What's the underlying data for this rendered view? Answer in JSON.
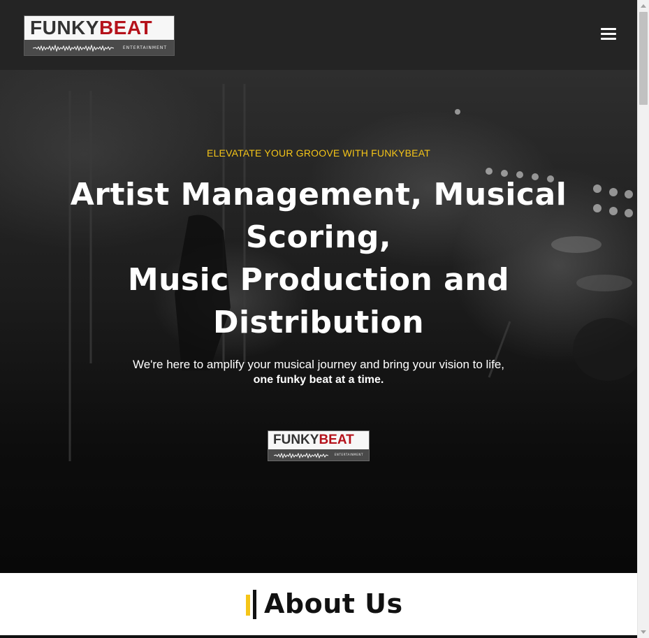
{
  "header": {
    "logo": {
      "word1": "FUNKY",
      "word2": "BEAT",
      "subtitle": "ENTERTAINMENT"
    },
    "menu_icon": "hamburger-menu-icon"
  },
  "hero": {
    "tagline": "ELEVATATE YOUR GROOVE WITH FUNKYBEAT",
    "headline_line1": "Artist Management, Musical Scoring,",
    "headline_line2": "Music Production and Distribution",
    "subtext": "We're here to amplify your musical journey and bring your vision to life,",
    "subtext_bold": "one funky beat at a time.",
    "logo": {
      "word1": "FUNKY",
      "word2": "BEAT",
      "subtitle": "ENTERTAINMENT"
    }
  },
  "about": {
    "title": "About Us"
  },
  "colors": {
    "accent": "#f5c518",
    "brand_red": "#b5121b",
    "header_bg": "#242424"
  }
}
